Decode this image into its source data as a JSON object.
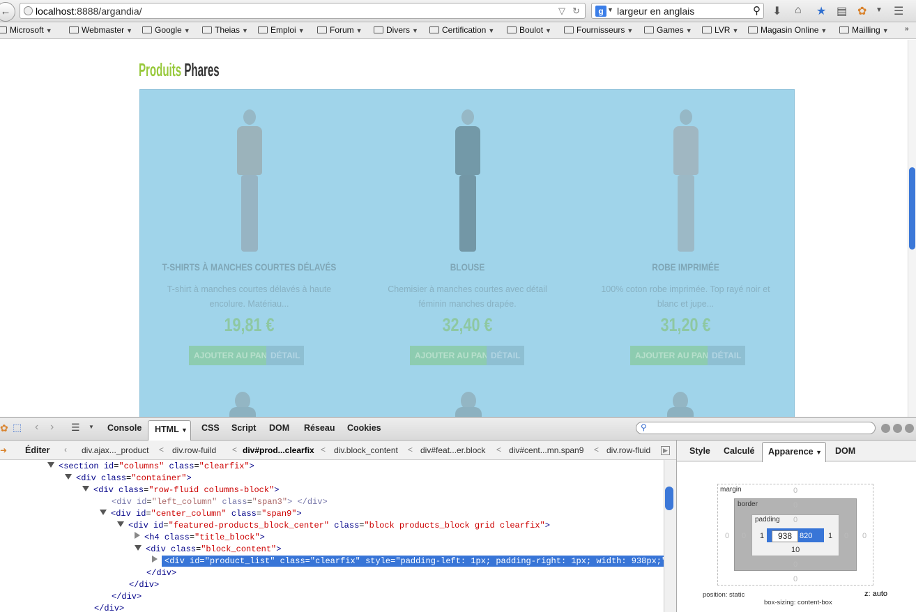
{
  "browser": {
    "url_host": "localhost",
    "url_path": ":8888/argandia/",
    "search_text": "largeur en anglais",
    "search_engine_letter": "g"
  },
  "bookmarks": [
    "Microsoft",
    "Webmaster",
    "Google",
    "Theias",
    "Emploi",
    "Forum",
    "Divers",
    "Certification",
    "Boulot",
    "Fournisseurs",
    "Games",
    "LVR",
    "Magasin Online",
    "Mailling"
  ],
  "page": {
    "title_part1": "Produits",
    "title_part2": "Phares",
    "products": [
      {
        "name": "T-shirts à manches courtes délavés",
        "desc": "T-shirt à manches courtes délavés à haute encolure. Matériau...",
        "price": "19,81 €",
        "cart": "Ajouter au panier",
        "detail": "Détail"
      },
      {
        "name": "Blouse",
        "desc": "Chemisier à manches courtes avec détail féminin manches drapée.",
        "price": "32,40 €",
        "cart": "Ajouter au panier",
        "detail": "Détail"
      },
      {
        "name": "Robe imprimée",
        "desc": "100% coton robe imprimée. Top rayé noir et blanc et jupe...",
        "price": "31,20 €",
        "cart": "Ajouter au panier",
        "detail": "Détail"
      }
    ]
  },
  "firebug": {
    "tabs": [
      "Console",
      "HTML",
      "CSS",
      "Script",
      "DOM",
      "Réseau",
      "Cookies"
    ],
    "edit_label": "Éditer",
    "breadcrumbs": [
      "div.ajax..._product",
      "div.row-fuild",
      "div#prod...clearfix",
      "div.block_content",
      "div#feat...er.block",
      "div#cent...mn.span9",
      "div.row-fluid"
    ],
    "side_tabs": [
      "Style",
      "Calculé",
      "Apparence",
      "DOM"
    ],
    "box": {
      "margin_label": "margin",
      "border_label": "border",
      "padding_label": "padding",
      "width": "938",
      "height": "820",
      "padding_left": "1",
      "padding_right": "1",
      "padding_bottom": "10",
      "zero": "0",
      "position": "position: static",
      "box_sizing": "box-sizing: content-box",
      "z": "z: auto"
    }
  },
  "tree": [
    {
      "indent": 68,
      "tw": "open",
      "tag": "section",
      "attrs": [
        [
          "id",
          "columns"
        ],
        [
          "class",
          "clearfix"
        ]
      ],
      "close": ""
    },
    {
      "indent": 93,
      "tw": "open",
      "tag": "div",
      "attrs": [
        [
          "class",
          "container"
        ]
      ],
      "close": ""
    },
    {
      "indent": 118,
      "tw": "open",
      "tag": "div",
      "attrs": [
        [
          "class",
          "row-fluid columns-block"
        ]
      ],
      "close": ""
    },
    {
      "indent": 160,
      "tw": "",
      "tag": "div",
      "attrs": [
        [
          "id",
          "left_column"
        ],
        [
          "class",
          "span3"
        ]
      ],
      "close": " </div>",
      "dim": true
    },
    {
      "indent": 143,
      "tw": "open",
      "tag": "div",
      "attrs": [
        [
          "id",
          "center_column"
        ],
        [
          "class",
          "span9"
        ]
      ],
      "close": ""
    },
    {
      "indent": 168,
      "tw": "open",
      "tag": "div",
      "attrs": [
        [
          "id",
          "featured-products_block_center"
        ],
        [
          "class",
          "block products_block grid clearfix"
        ]
      ],
      "close": ""
    },
    {
      "indent": 193,
      "tw": "closed",
      "tag": "h4",
      "attrs": [
        [
          "class",
          "title_block"
        ]
      ],
      "close": ""
    },
    {
      "indent": 193,
      "tw": "open",
      "tag": "div",
      "attrs": [
        [
          "class",
          "block_content"
        ]
      ],
      "close": ""
    },
    {
      "indent": 218,
      "tw": "closed",
      "tag": "div",
      "attrs": [
        [
          "id",
          "product_list"
        ],
        [
          "class",
          "clearfix"
        ],
        [
          "style",
          "padding-left: 1px; padding-right: 1px; width: 938px;"
        ]
      ],
      "close": "",
      "hl": true
    },
    {
      "indent": 210,
      "tw": "",
      "endtag": "</div>"
    },
    {
      "indent": 185,
      "tw": "",
      "endtag": "</div>"
    },
    {
      "indent": 160,
      "tw": "",
      "endtag": "</div>"
    },
    {
      "indent": 135,
      "tw": "",
      "endtag": "</div>"
    }
  ]
}
